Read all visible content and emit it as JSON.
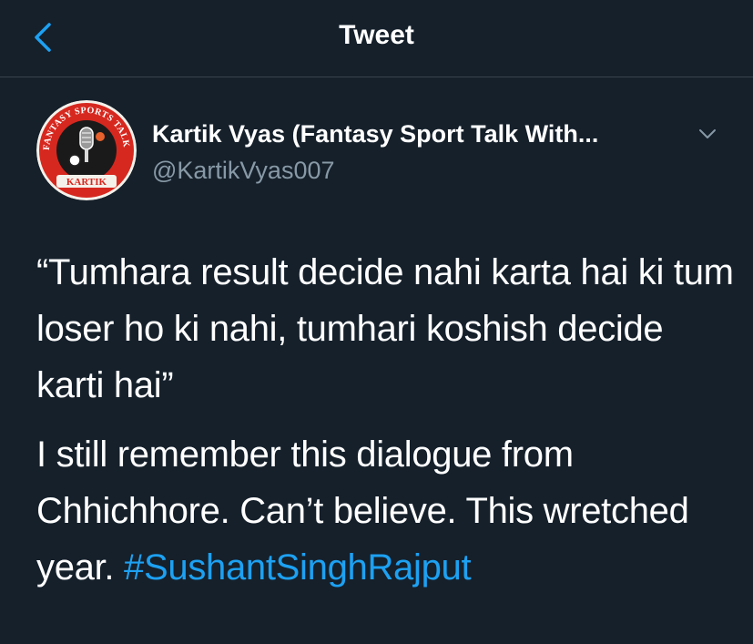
{
  "header": {
    "title": "Tweet",
    "back_icon": "chevron-left-icon",
    "accent": "#1da1f2"
  },
  "author": {
    "display_name": "Kartik Vyas (Fantasy Sport Talk With...",
    "handle": "@KartikVyas007",
    "avatar": {
      "ring_text": "FANTASY SPORTS TALK WITH",
      "name_text": "KARTIK"
    },
    "menu_icon": "chevron-down-icon"
  },
  "tweet": {
    "quote": "“Tumhara result decide nahi karta hai ki tum loser ho ki nahi, tumhari koshish decide karti hai”",
    "body_text": "I still remember this dialogue from Chhichhore. Can’t believe. This wretched year. ",
    "hashtag": "#SushantSinghRajput"
  },
  "colors": {
    "background": "#15202b",
    "text": "#ffffff",
    "secondary_text": "#8899a6",
    "link": "#1da1f2"
  }
}
